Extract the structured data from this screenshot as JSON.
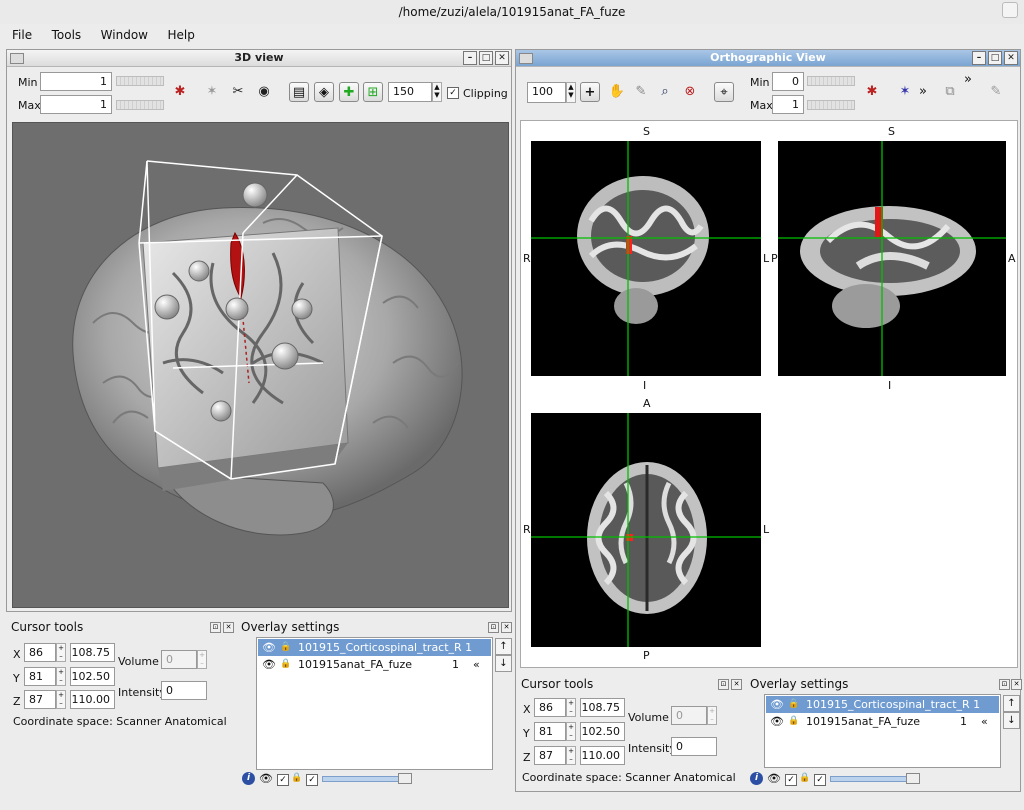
{
  "window": {
    "title": "/home/zuzi/alela/101915anat_FA_fuze"
  },
  "menu": [
    "File",
    "Tools",
    "Window",
    "Help"
  ],
  "view3d": {
    "title": "3D view",
    "min_label": "Min",
    "min_value": "1",
    "max_label": "Max",
    "max_value": "1",
    "zoom_value": "150",
    "clipping_label": "Clipping",
    "clipping_checked": true
  },
  "ortho": {
    "title": "Orthographic View",
    "zoom_value": "100",
    "min_label": "Min",
    "min_value": "0",
    "max_label": "Max",
    "max_value": "1",
    "more": "»",
    "coronal": {
      "top": "S",
      "bottom": "I",
      "left": "R",
      "right": "L"
    },
    "sagittal": {
      "top": "S",
      "bottom": "I",
      "left": "P",
      "right": "A"
    },
    "axial": {
      "top": "A",
      "bottom": "P",
      "left": "R",
      "right": "L"
    }
  },
  "cursor_tools_left": {
    "title": "Cursor tools",
    "x_label": "X",
    "x_voxel": "86",
    "x_world": "108.75",
    "y_label": "Y",
    "y_voxel": "81",
    "y_world": "102.50",
    "z_label": "Z",
    "z_voxel": "87",
    "z_world": "110.00",
    "volume_label": "Volume",
    "volume_value": "0",
    "intensity_label": "Intensity",
    "intensity_value": "0",
    "coord_space": "Coordinate space: Scanner Anatomical"
  },
  "cursor_tools_right": {
    "title": "Cursor tools",
    "x_label": "X",
    "x_voxel": "86",
    "x_world": "108.75",
    "y_label": "Y",
    "y_voxel": "81",
    "y_world": "102.50",
    "z_label": "Z",
    "z_voxel": "87",
    "z_world": "110.00",
    "volume_label": "Volume",
    "volume_value": "0",
    "intensity_label": "Intensity",
    "intensity_value": "0",
    "coord_space": "Coordinate space: Scanner Anatomical"
  },
  "overlay_left": {
    "title": "Overlay settings",
    "rows": [
      {
        "name": "101915_Corticospinal_tract_R 1",
        "num": ""
      },
      {
        "name": "101915anat_FA_fuze",
        "num": "1"
      }
    ],
    "selected_index": 0
  },
  "overlay_right": {
    "title": "Overlay settings",
    "rows": [
      {
        "name": "101915_Corticospinal_tract_R 1",
        "num": ""
      },
      {
        "name": "101915anat_FA_fuze",
        "num": "1"
      }
    ],
    "selected_index": 0
  },
  "icons": {
    "eye": "eye-icon",
    "lock": "lock-icon",
    "info": "info-icon",
    "plus": "crosshair-plus-icon",
    "hand": "pan-hand-icon",
    "pencil": "pencil-icon",
    "zoom": "magnifier-icon",
    "locate": "target-icon"
  },
  "colors": {
    "selection": "#6f9bd1",
    "pane_title_active": "#7aa4d2",
    "cursor": "#00c000",
    "tract": "#c00000"
  }
}
